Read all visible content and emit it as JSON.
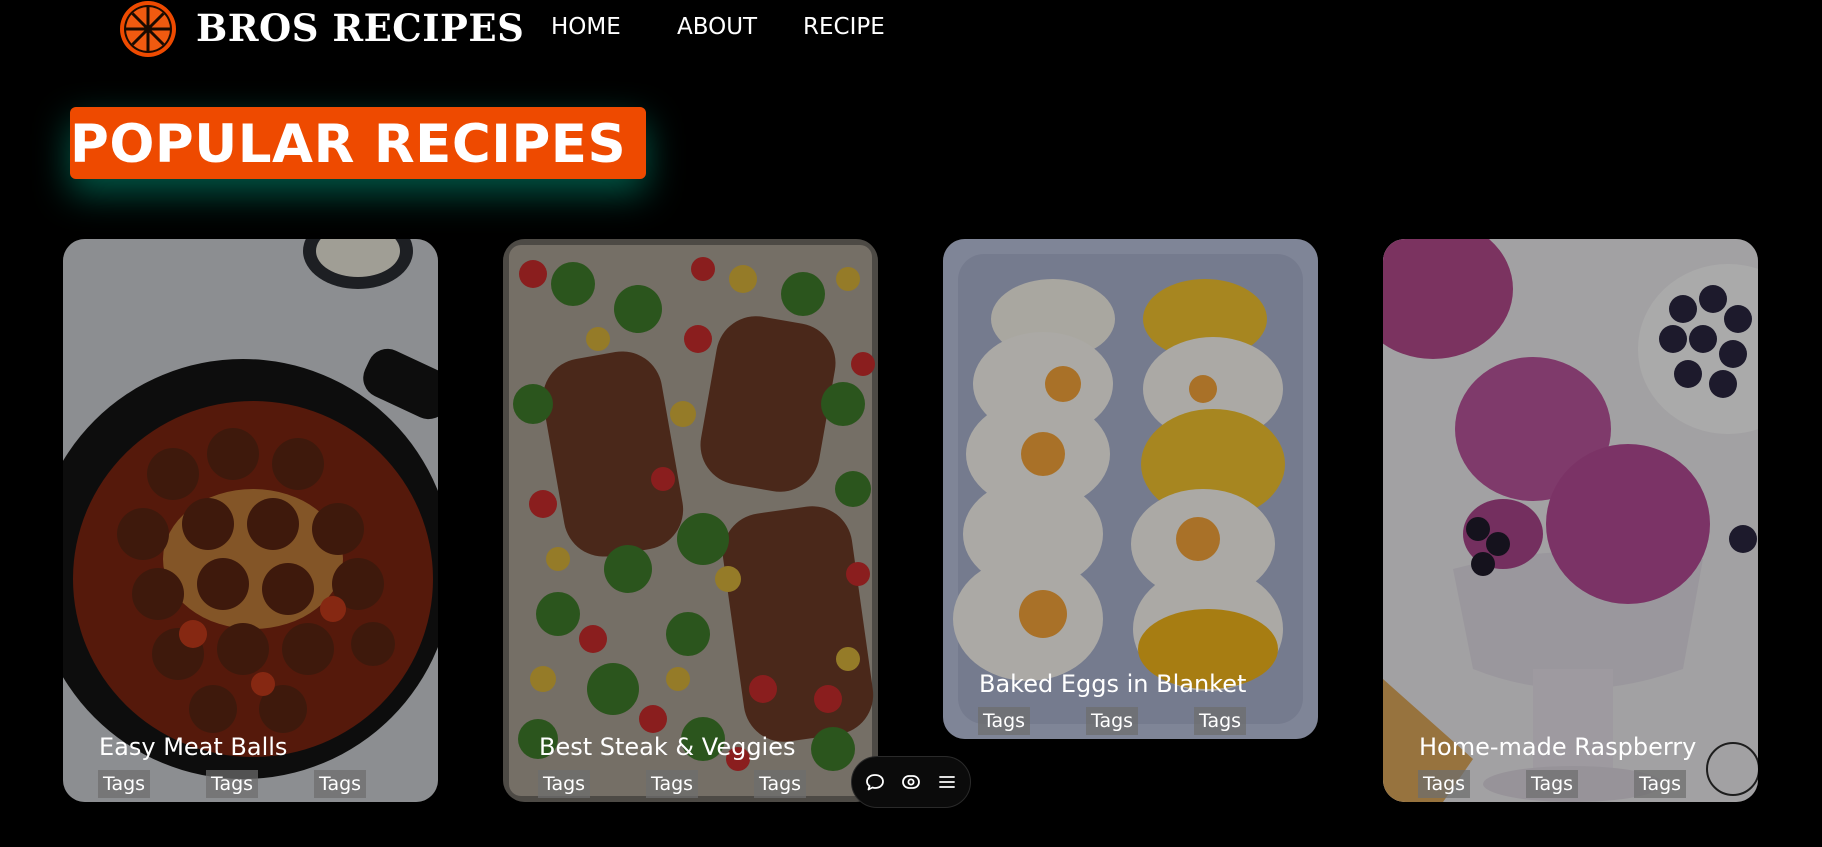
{
  "header": {
    "brand": "BROS RECIPES",
    "logo_icon": "orange-slice-icon",
    "brand_color": "#ee4a00",
    "nav": [
      {
        "label": "HOME"
      },
      {
        "label": "ABOUT"
      },
      {
        "label": "RECIPE"
      }
    ]
  },
  "section": {
    "title": "POPULAR RECIPES",
    "accent": "#ee4a00"
  },
  "cards": [
    {
      "title": "Easy Meat Balls",
      "tags": [
        "Tags",
        "Tags",
        "Tags"
      ]
    },
    {
      "title": "Best Steak & Veggies",
      "tags": [
        "Tags",
        "Tags",
        "Tags"
      ]
    },
    {
      "title": "Baked Eggs in Blanket",
      "tags": [
        "Tags",
        "Tags",
        "Tags"
      ]
    },
    {
      "title": "Home-made Raspberry",
      "tags": [
        "Tags",
        "Tags",
        "Tags"
      ]
    }
  ],
  "toolbar": {
    "icons": [
      "comment-icon",
      "eye-icon",
      "menu-icon"
    ]
  }
}
